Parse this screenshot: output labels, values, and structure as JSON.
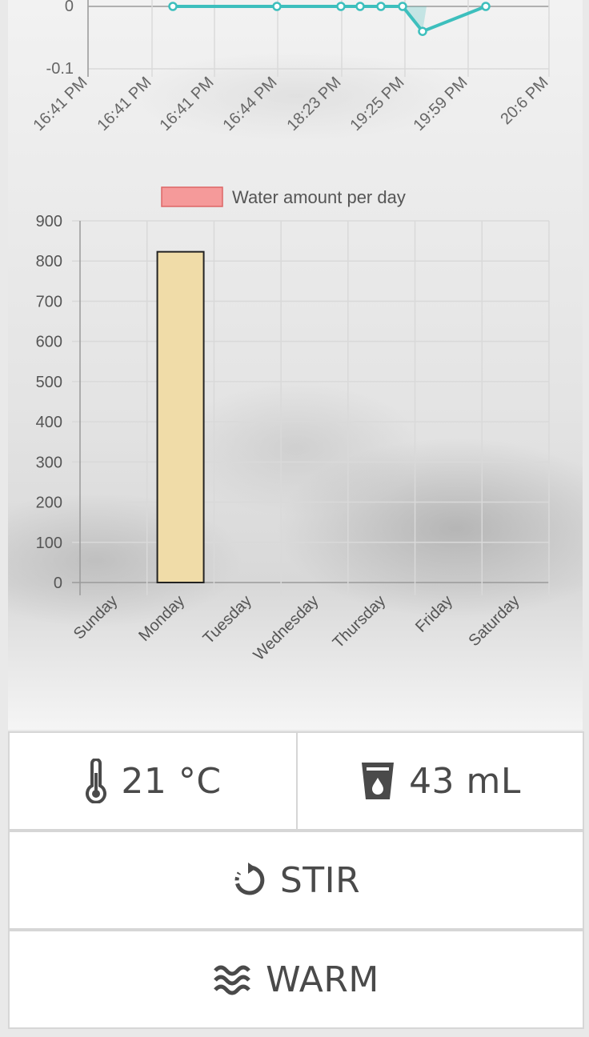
{
  "line_chart": {
    "y_tick_labels": [
      "0",
      "-0.1"
    ],
    "x_tick_labels": [
      "16:41 PM",
      "16:41 PM",
      "16:41 PM",
      "16:44 PM",
      "18:23 PM",
      "19:25 PM",
      "19:59 PM",
      "20:6 PM"
    ],
    "series_color": "#3dbfbd",
    "points": [
      {
        "x": "16:41 PM",
        "y": 0
      },
      {
        "x": "16:44 PM",
        "y": 0
      },
      {
        "x": "18:23 PM",
        "y": 0
      },
      {
        "x": "18:23 PM",
        "y": 0
      },
      {
        "x": "19:25 PM",
        "y": 0
      },
      {
        "x": "19:25 PM",
        "y": 0
      },
      {
        "x": "19:25 PM",
        "y": -0.04
      },
      {
        "x": "19:59 PM",
        "y": 0
      }
    ]
  },
  "chart_data": {
    "type": "bar",
    "categories": [
      "Sunday",
      "Monday",
      "Tuesday",
      "Wednesday",
      "Thursday",
      "Friday",
      "Saturday"
    ],
    "series": [
      {
        "name": "Water amount per day",
        "values": [
          0,
          823,
          0,
          0,
          0,
          0,
          0
        ]
      }
    ],
    "ylim": [
      0,
      900
    ],
    "yticks": [
      0,
      100,
      200,
      300,
      400,
      500,
      600,
      700,
      800,
      900
    ],
    "grid": true,
    "legend": "top",
    "legend_swatch_color": "#f59a9a",
    "bar_color": "#f0dca8"
  },
  "controls": {
    "temperature": {
      "icon": "thermometer-icon",
      "value": "21 °C"
    },
    "water": {
      "icon": "cup-icon",
      "value": "43 mL"
    },
    "stir": {
      "icon": "rotate-icon",
      "label": "STIR"
    },
    "warm": {
      "icon": "heat-waves-icon",
      "label": "WARM"
    }
  }
}
